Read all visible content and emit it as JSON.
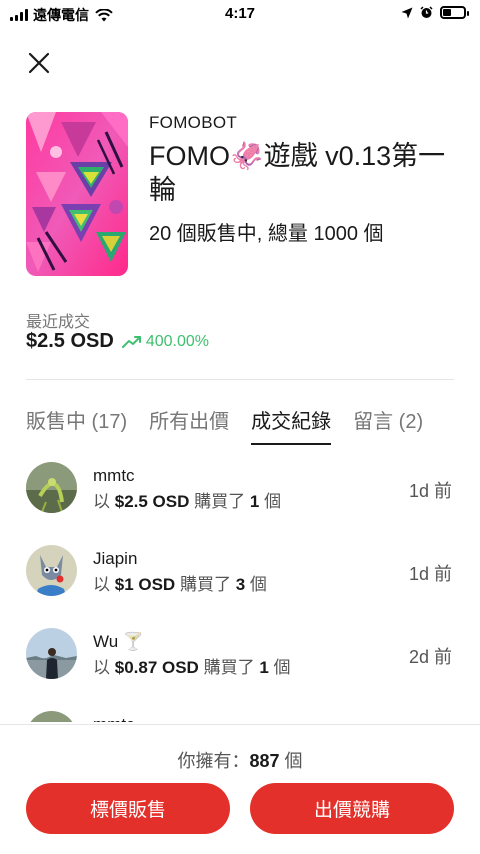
{
  "status_bar": {
    "carrier": "遠傳電信",
    "time": "4:17"
  },
  "nft": {
    "creator": "FOMOBOT",
    "title": "FOMO🦑遊戲 v0.13第一輪",
    "supply": "20 個販售中, 總量 1000 個",
    "recent_label": "最近成交",
    "recent_price": "$2.5 OSD",
    "recent_change": "400.00%"
  },
  "tabs": [
    {
      "label": "販售中 (17)",
      "active": false
    },
    {
      "label": "所有出價",
      "active": false
    },
    {
      "label": "成交紀錄",
      "active": true
    },
    {
      "label": "留言 (2)",
      "active": false
    }
  ],
  "transactions": [
    {
      "name": "mmtc",
      "prefix": "以",
      "price": "$2.5 OSD",
      "verb": "購買了",
      "qty": "1",
      "unit": "個",
      "time": "1d 前"
    },
    {
      "name": "Jiapin",
      "prefix": "以",
      "price": "$1 OSD",
      "verb": "購買了",
      "qty": "3",
      "unit": "個",
      "time": "1d 前"
    },
    {
      "name": "Wu 🍸",
      "prefix": "以",
      "price": "$0.87 OSD",
      "verb": "購買了",
      "qty": "1",
      "unit": "個",
      "time": "2d 前"
    },
    {
      "name": "mmtc",
      "prefix": "",
      "price": "",
      "verb": "",
      "qty": "",
      "unit": "",
      "time": ""
    }
  ],
  "footer": {
    "own_label": "你擁有：",
    "own_count": "887",
    "own_unit": "個",
    "sell_button": "標價販售",
    "bid_button": "出價競購"
  },
  "colors": {
    "accent": "#e4302a",
    "positive": "#3fbf6f"
  }
}
